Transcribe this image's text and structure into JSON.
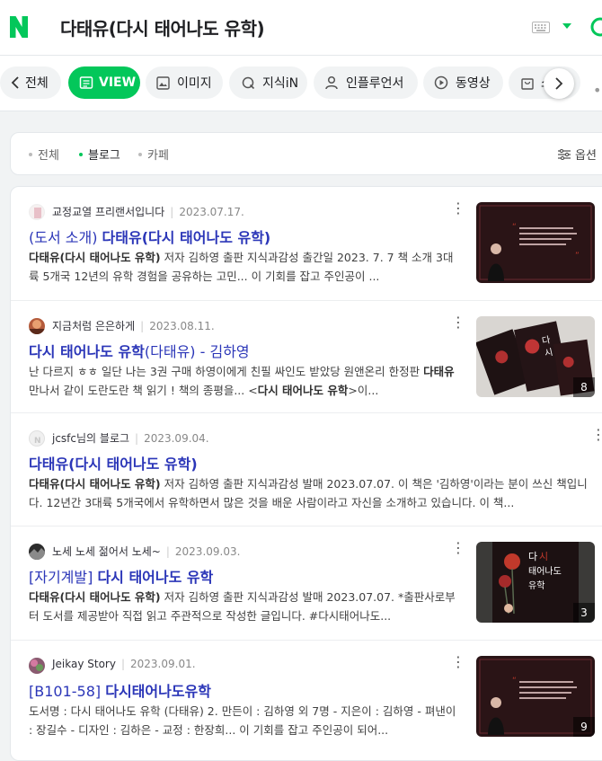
{
  "header": {
    "logo": "N",
    "query": "다태유(다시 태어나도 유학)"
  },
  "tabs": [
    {
      "label": "전체",
      "icon": "chevron-left-icon",
      "active": false
    },
    {
      "label": "VIEW",
      "icon": "view-doc-icon",
      "active": true
    },
    {
      "label": "이미지",
      "icon": "image-icon",
      "active": false
    },
    {
      "label": "지식iN",
      "icon": "q-icon",
      "active": false
    },
    {
      "label": "인플루언서",
      "icon": "person-icon",
      "active": false
    },
    {
      "label": "동영상",
      "icon": "play-icon",
      "active": false
    },
    {
      "label": "쇼",
      "icon": "shopping-icon",
      "active": false
    }
  ],
  "filter": {
    "items": [
      {
        "label": "전체",
        "active": false
      },
      {
        "label": "블로그",
        "active": true
      },
      {
        "label": "카페",
        "active": false
      }
    ],
    "option_label": "옵션"
  },
  "results": [
    {
      "source": "교정교열 프리랜서입니다",
      "date": "2023.07.17.",
      "title_prefix": "(도서 소개) ",
      "title_bold": "다태유(다시 태어나도 유학)",
      "title_suffix": "",
      "desc_bold": "다태유(다시 태어나도 유학)",
      "desc_rest": " 저자 김하영 출판 지식과감성 출간일 2023. 7. 7 책 소개 3대륙 5개국 12년의 유학 경험을 공유하는 고민... 이 기회를 잡고 주인공이 ...",
      "thumb": "dark-red",
      "count": ""
    },
    {
      "source": "지금처럼 은은하게",
      "date": "2023.08.11.",
      "title_prefix": "",
      "title_bold": "다시 태어나도 유학",
      "title_suffix": "(다태유) - 김하영",
      "desc_pre": "난 다르지 ㅎㅎ 일단 나는 3권 구매 하영이에게 친필 싸인도 받았당 원앤온리 한정판 ",
      "desc_bold": "다태유",
      "desc_mid": " 만나서 같이 도란도란 책 읽기 ! 책의 종평을... <",
      "desc_bold2": "다시 태어나도 유학",
      "desc_rest": ">이...",
      "thumb": "books",
      "count": "8"
    },
    {
      "source": "jcsfc님의 블로그",
      "date": "2023.09.04.",
      "title_prefix": "",
      "title_bold": "다태유(다시 태어나도 유학)",
      "title_suffix": "",
      "desc_bold": "다태유(다시 태어나도 유학)",
      "desc_rest": " 저자 김하영 출판 지식과감성 발매 2023.07.07. 이 책은 '김하영'이라는 분이 쓰신 책입니다. 12년간 3대륙 5개국에서 유학하면서 많은 것을 배운 사람이라고 자신을 소개하고 있습니다. 이 책...",
      "thumb": "",
      "count": ""
    },
    {
      "source": "노세 노세 젊어서 노세~",
      "date": "2023.09.03.",
      "title_prefix": "[자기계발] ",
      "title_bold": "다시 태어나도 유학",
      "title_suffix": "",
      "desc_bold": "다태유(다시 태어나도 유학)",
      "desc_rest": " 저자 김하영 출판 지식과감성 발매 2023.07.07. *출판사로부터 도서를 제공받아 직접 읽고 주관적으로 작성한 글입니다. #다시태어나도...",
      "thumb": "cover",
      "count": "3"
    },
    {
      "source": "Jeikay Story",
      "date": "2023.09.01.",
      "title_prefix": "[B101-58] ",
      "title_bold": "다시태어나도유학",
      "title_suffix": "",
      "desc_bold": "",
      "desc_rest": "도서명 : 다시 태어나도 유학 (다태유) 2. 만든이 : 김하영 외 7명 - 지은이 : 김하영 - 펴낸이 : 장길수 - 디자인 : 김하은 - 교정 : 한장희... 이 기회를 잡고 주인공이 되어...",
      "thumb": "dark-red",
      "count": "9"
    }
  ],
  "thumb_texts": {
    "cover_title": "다 시 태어나도 유학",
    "cover_lines": "3대륙 5개국 12년간\n유학 경험을 공유하는 고민\n상담을 응원한다. 모두에게\n세상 다녀오는 건 필요 없다"
  },
  "colors": {
    "accent": "#03c75a",
    "link": "#2b36b8",
    "thumb_dark": "#2a1416"
  }
}
